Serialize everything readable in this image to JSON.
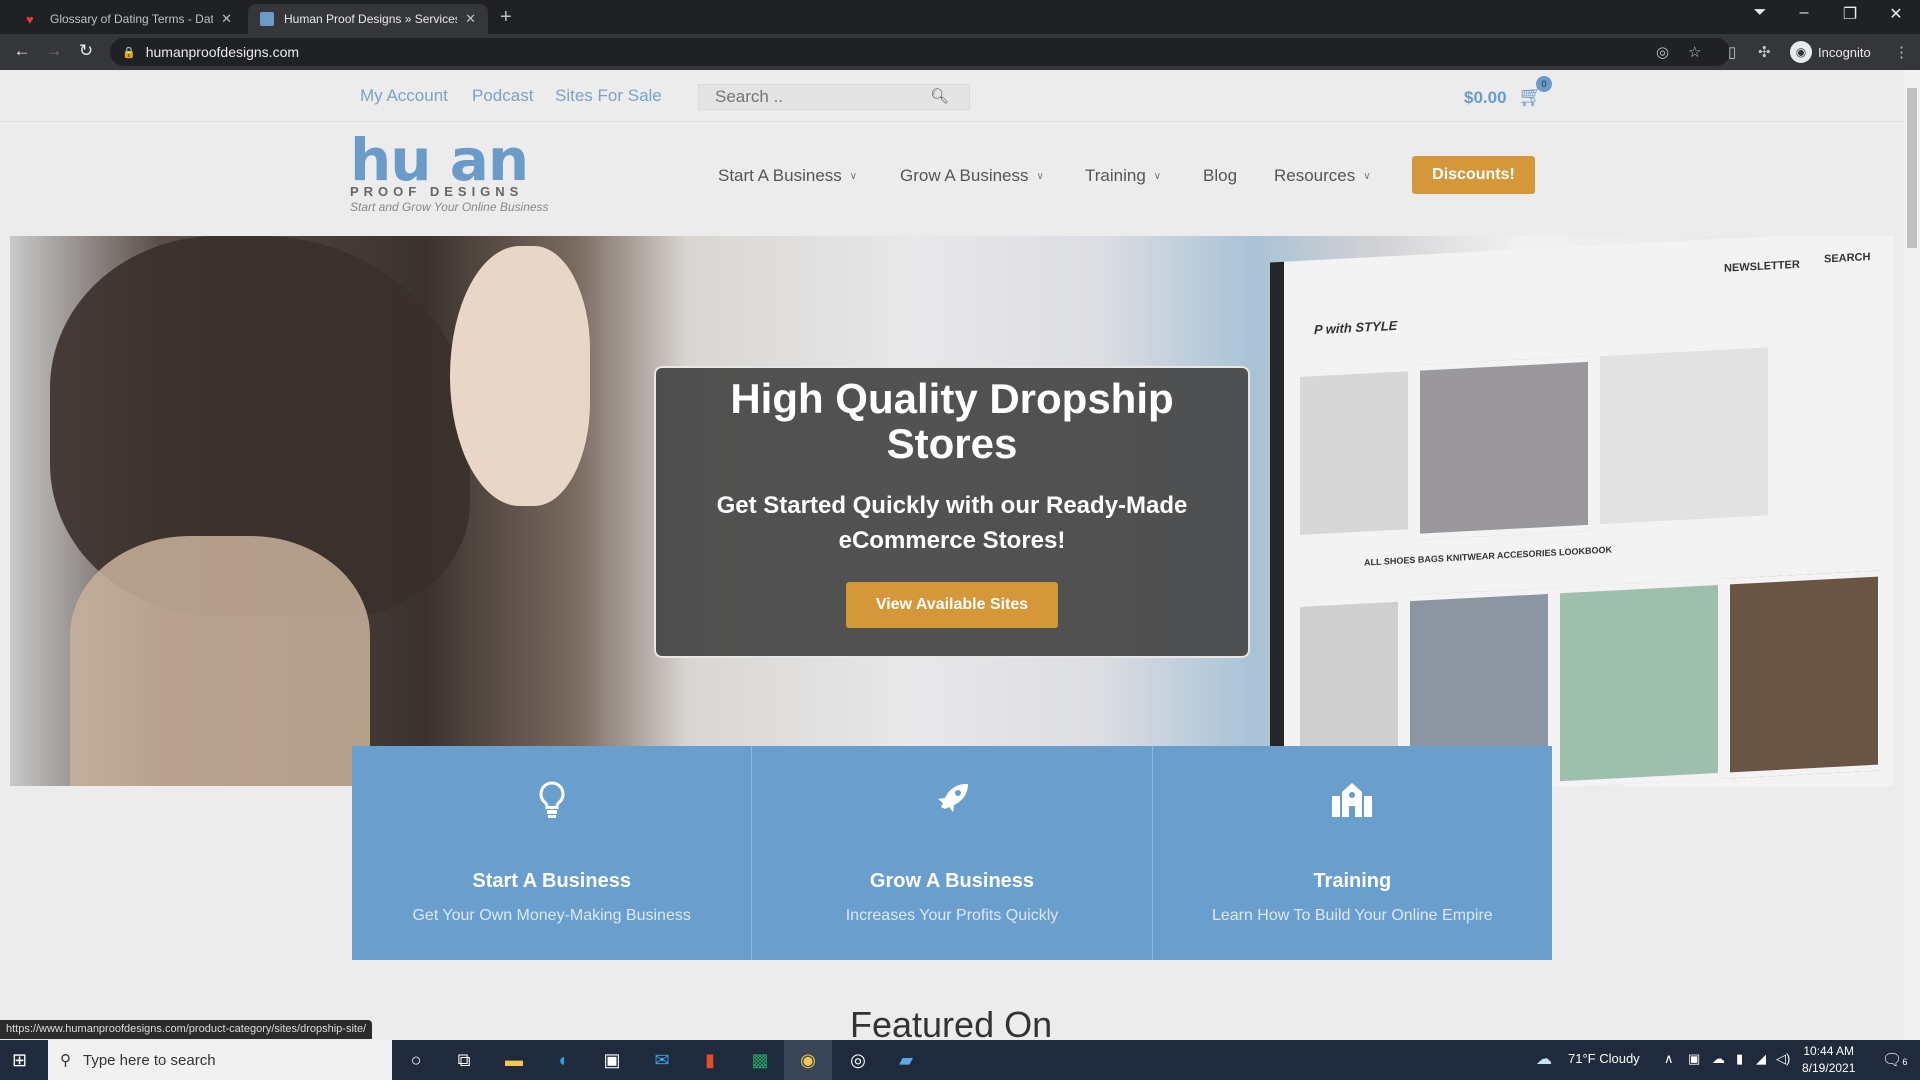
{
  "browser": {
    "tabs": [
      {
        "title": "Glossary of Dating Terms - Datin",
        "favicon": "heart-icon",
        "active": false
      },
      {
        "title": "Human Proof Designs » Services",
        "favicon": "hpd-icon",
        "active": true
      }
    ],
    "new_tab": "+",
    "url": "humanproofdesigns.com",
    "profile_label": "Incognito",
    "window_controls": {
      "minimize": "–",
      "restore": "❐",
      "close": "✕"
    }
  },
  "topbar": {
    "links": [
      "My Account",
      "Podcast",
      "Sites For Sale"
    ],
    "search_placeholder": "Search ..",
    "cart_total": "$0.00",
    "cart_count": "0"
  },
  "header": {
    "logo": {
      "word": "hu  an",
      "sub": "PROOF DESIGNS",
      "tagline": "Start and Grow Your Online Business"
    },
    "nav": [
      {
        "label": "Start A Business",
        "dropdown": true
      },
      {
        "label": "Grow A Business",
        "dropdown": true
      },
      {
        "label": "Training",
        "dropdown": true
      },
      {
        "label": "Blog",
        "dropdown": false
      },
      {
        "label": "Resources",
        "dropdown": true
      }
    ],
    "cta": "Discounts!"
  },
  "hero": {
    "title": "High Quality Dropship Stores",
    "subtitle": "Get Started Quickly with our Ready-Made eCommerce Stores!",
    "button": "View Available Sites",
    "monitor_texts": {
      "newsletter": "NEWSLETTER",
      "search": "SEARCH",
      "brand": "P with STYLE",
      "categories": "ALL  SHOES  BAGS  KNITWEAR  ACCESORIES  LOOKBOOK"
    }
  },
  "features": [
    {
      "icon": "lightbulb-icon",
      "glyph": "💡",
      "title": "Start A Business",
      "desc": "Get Your Own Money-Making Business"
    },
    {
      "icon": "rocket-icon",
      "glyph": "🚀",
      "title": "Grow A Business",
      "desc": "Increases Your Profits Quickly"
    },
    {
      "icon": "school-icon",
      "glyph": "🏫",
      "title": "Training",
      "desc": "Learn How To Build Your Online Empire"
    }
  ],
  "featured_heading": "Featured On",
  "status_url": "https://www.humanproofdesigns.com/product-category/sites/dropship-site/",
  "taskbar": {
    "search_placeholder": "Type here to search",
    "weather": "71°F  Cloudy",
    "time": "10:44 AM",
    "date": "8/19/2021",
    "notifications": "6"
  },
  "colors": {
    "brand_blue": "#6a9bc9",
    "accent_orange": "#d4973a",
    "feature_blue": "#6a9fcd"
  }
}
